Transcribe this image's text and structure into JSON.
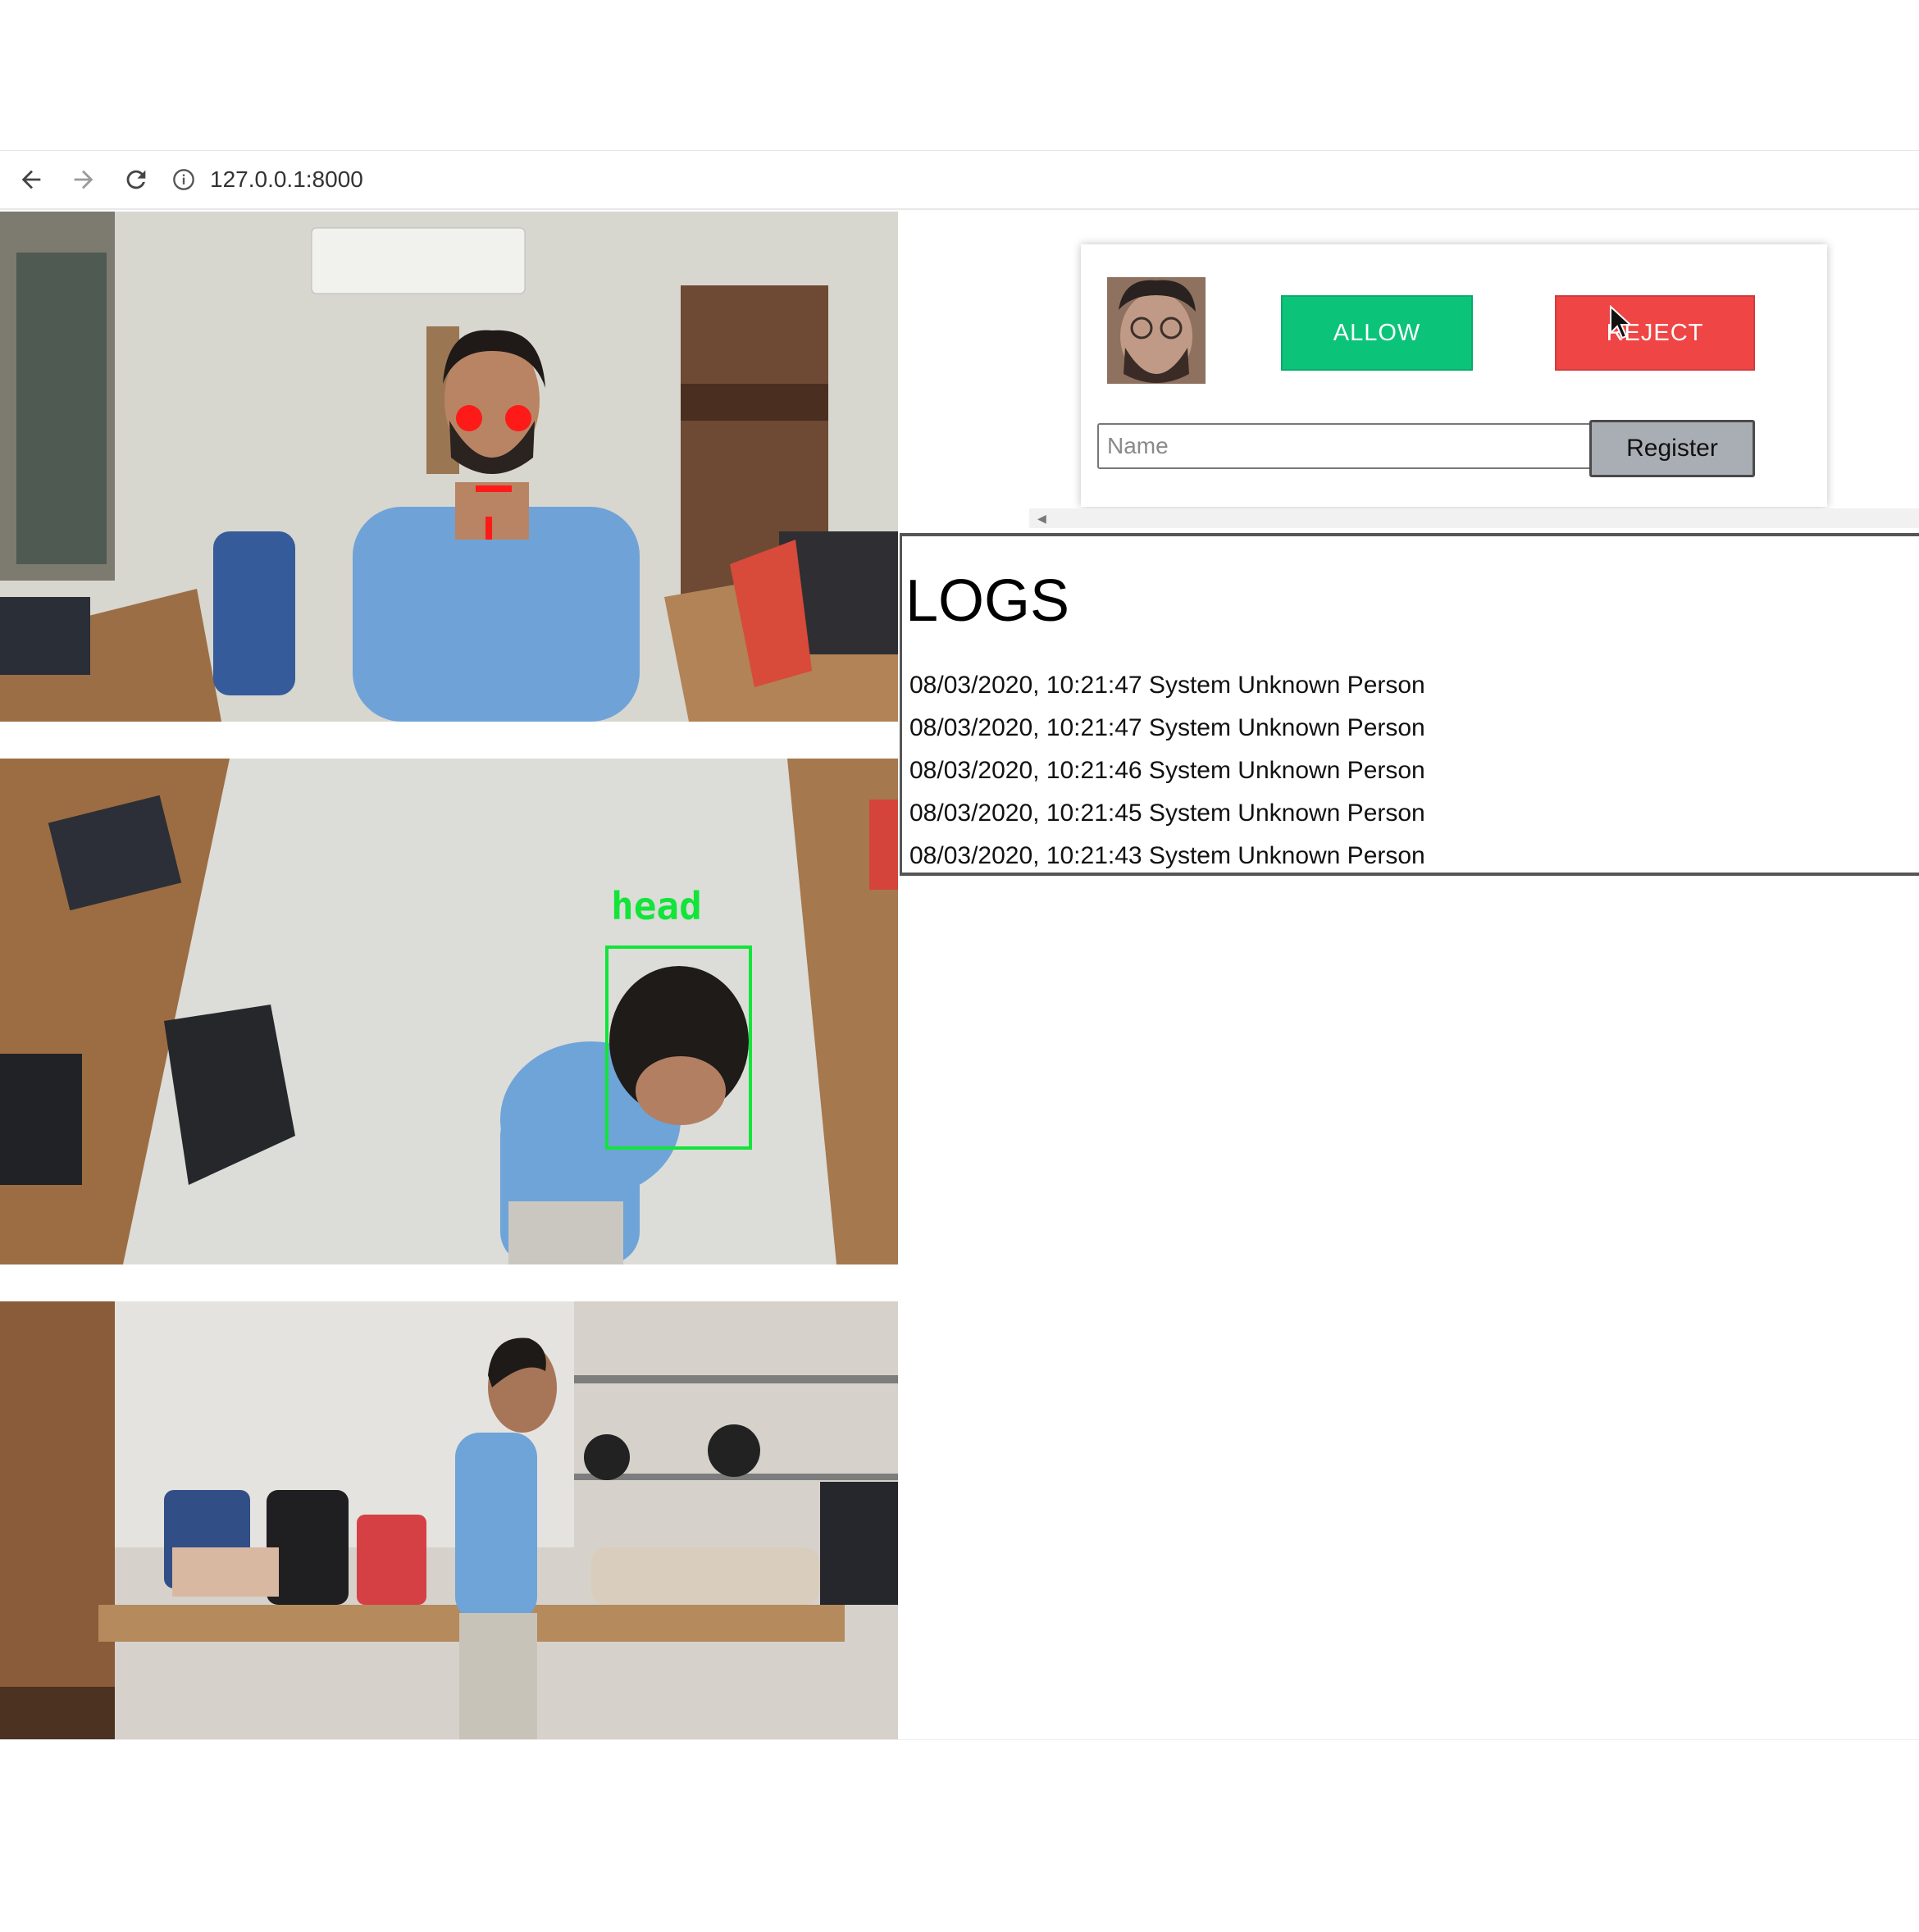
{
  "browser": {
    "url": "127.0.0.1:8000",
    "back_icon": "arrow-left-icon",
    "forward_icon": "arrow-right-icon",
    "reload_icon": "reload-icon",
    "info_icon": "info-icon"
  },
  "feeds": [
    {
      "name": "camera-feed-1",
      "overlay": "face-landmarks"
    },
    {
      "name": "camera-feed-2",
      "overlay_label": "head"
    },
    {
      "name": "camera-feed-3"
    }
  ],
  "panel": {
    "allow_label": "ALLOW",
    "reject_label": "REJECT",
    "name_placeholder": "Name",
    "name_value": "",
    "register_label": "Register",
    "colors": {
      "allow": "#0bc47a",
      "reject": "#ef4545",
      "register": "#a9aeb5"
    }
  },
  "logs": {
    "title": "LOGS",
    "entries": [
      "08/03/2020, 10:21:47 System Unknown Person",
      "08/03/2020, 10:21:47 System Unknown Person",
      "08/03/2020, 10:21:46 System Unknown Person",
      "08/03/2020, 10:21:45 System Unknown Person",
      "08/03/2020, 10:21:43 System Unknown Person"
    ]
  }
}
